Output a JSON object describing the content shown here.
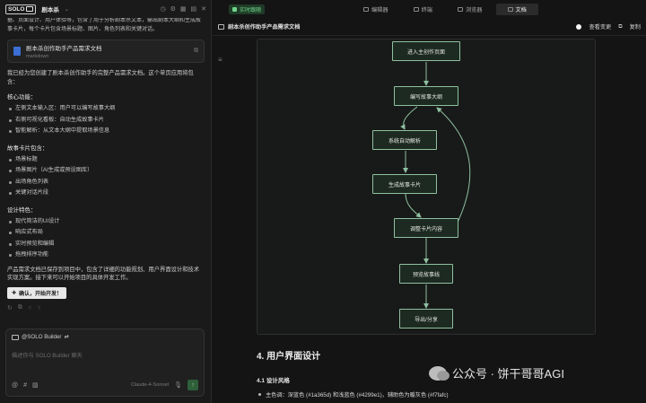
{
  "left": {
    "logo": "SOLO",
    "project": "剧本杀",
    "intro": "据、页面设计、用户体验等，包含了用于分析剧本杀文本，输出剧本大纲和生成故事卡片，每个卡片包含场景标题、图片、角色列表和关键对话。",
    "doc_card": {
      "title": "剧本杀创作助手产品需求文档",
      "type": "markdown"
    },
    "summary": "我已经为您创建了剧本杀创作助手的完整产品需求文档。这个单页应用将包含：",
    "sections": [
      {
        "title": "核心功能：",
        "items": [
          "左侧文本输入区：用户可以编写故事大纲",
          "右侧可视化看板：自动生成故事卡片",
          "智能解析：从文本大纲中提取场景信息"
        ]
      },
      {
        "title": "故事卡片包含：",
        "items": [
          "场景标题",
          "场景图片（AI生成或预设图库）",
          "出场角色列表",
          "关键对话片段"
        ]
      },
      {
        "title": "设计特色：",
        "items": [
          "现代简洁的UI设计",
          "响应式布局",
          "实时预览和编辑",
          "拖拽排序功能"
        ]
      }
    ],
    "closing": "产品需求文档已保存到项目中，包含了详细的功能规划、用户界面设计和技术实现方案。接下来可以开始项目的具体开发工作。",
    "confirm_button": "确认，开始开发！",
    "composer": {
      "tag": "@SOLO Builder",
      "placeholder": "描述你与 SOLO Builder 聊天",
      "model": "Claude-4-Sonnet"
    }
  },
  "right": {
    "live_label": "实时跟随",
    "tabs": [
      "编辑器",
      "终端",
      "浏览器",
      "文档"
    ],
    "active_tab": 3,
    "doc_title": "剧本杀创作助手产品需求文档",
    "actions": [
      "查看变更",
      "复制"
    ],
    "flow_nodes": [
      "进入主创作页面",
      "编写故事大纲",
      "系统自动解析",
      "生成故事卡片",
      "调整卡片内容",
      "预览故事线",
      "导出/分享"
    ],
    "heading": "4. 用户界面设计",
    "subheading": "4.1 设计风格",
    "color_line": "主色调：深蓝色 (#1a365d) 和浅蓝色 (#4299e1)，辅助色为暖灰色 (#f7fafc)"
  },
  "watermark": "公众号 · 饼干哥哥AGI"
}
